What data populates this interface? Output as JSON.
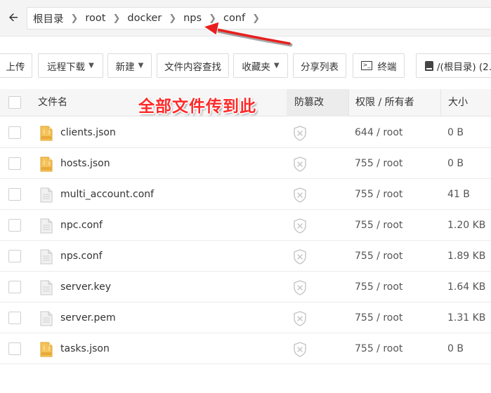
{
  "breadcrumb": [
    "根目录",
    "root",
    "docker",
    "nps",
    "conf"
  ],
  "toolbar": {
    "upload": "上传",
    "remote_download": "远程下载",
    "new": "新建",
    "content_search": "文件内容查找",
    "favorites": "收藏夹",
    "share_list": "分享列表",
    "terminal": "终端",
    "disk": "/(根目录) (2..."
  },
  "table": {
    "headers": {
      "name": "文件名",
      "guard": "防篡改",
      "perm": "权限 / 所有者",
      "size": "大小"
    },
    "rows": [
      {
        "name": "clients.json",
        "perm": "644 / root",
        "size": "0 B",
        "icon": "json-file-icon"
      },
      {
        "name": "hosts.json",
        "perm": "755 / root",
        "size": "0 B",
        "icon": "json-file-icon"
      },
      {
        "name": "multi_account.conf",
        "perm": "755 / root",
        "size": "41 B",
        "icon": "text-file-icon"
      },
      {
        "name": "npc.conf",
        "perm": "755 / root",
        "size": "1.20 KB",
        "icon": "text-file-icon"
      },
      {
        "name": "nps.conf",
        "perm": "755 / root",
        "size": "1.89 KB",
        "icon": "text-file-icon"
      },
      {
        "name": "server.key",
        "perm": "755 / root",
        "size": "1.64 KB",
        "icon": "text-file-icon"
      },
      {
        "name": "server.pem",
        "perm": "755 / root",
        "size": "1.31 KB",
        "icon": "text-file-icon"
      },
      {
        "name": "tasks.json",
        "perm": "755 / root",
        "size": "0 B",
        "icon": "json-file-icon"
      }
    ]
  },
  "annotation": {
    "text": "全部文件传到此",
    "color": "#ff2a2a"
  },
  "colors": {
    "json_icon": "#f0b63c",
    "text_icon": "#c9c9c9",
    "shield": "#bdbdbd"
  }
}
